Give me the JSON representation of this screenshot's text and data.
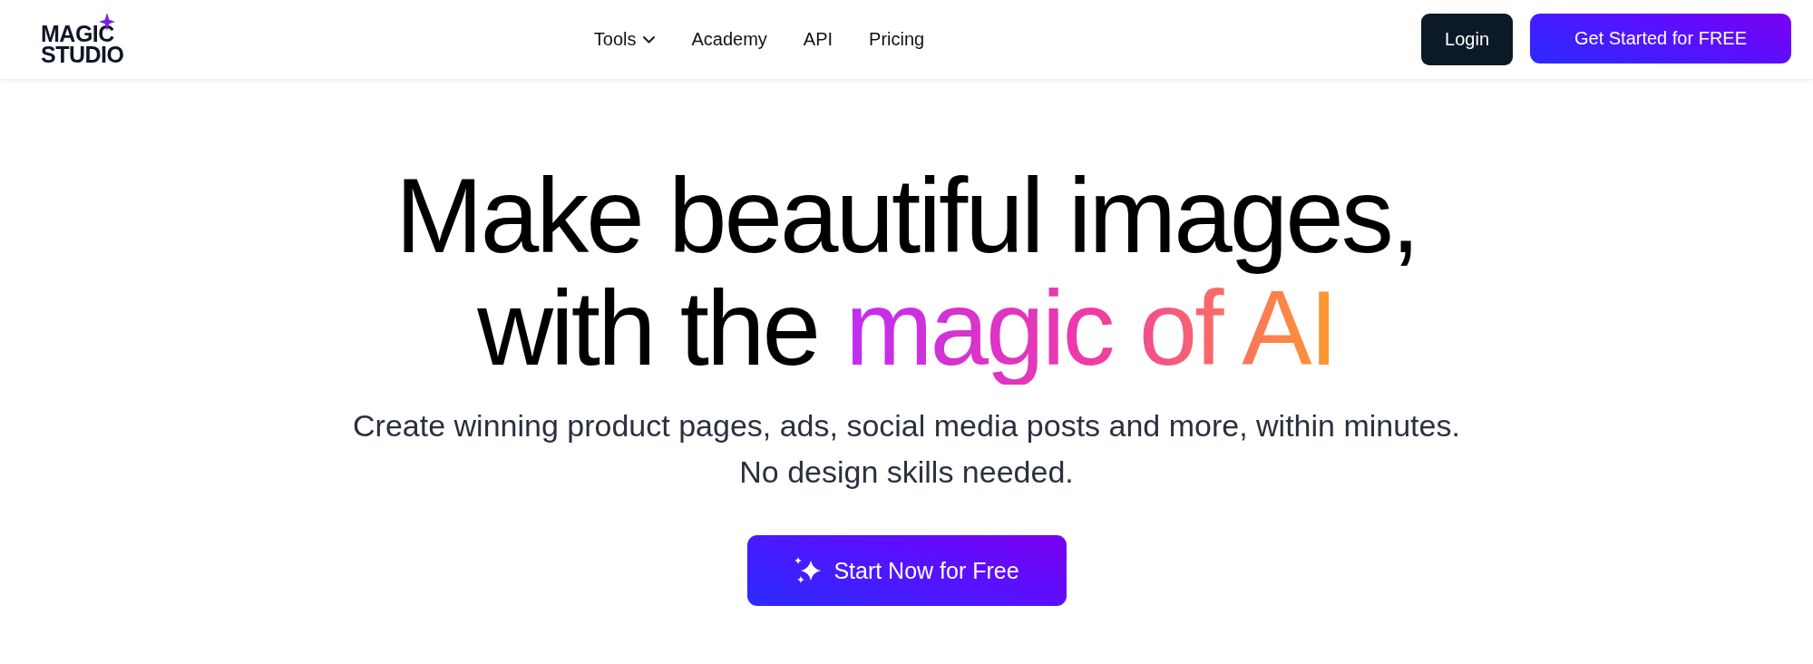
{
  "logo": {
    "line_1": "MAGIC",
    "line_2": "STUDIO"
  },
  "nav": [
    {
      "label": "Tools",
      "has_menu": true
    },
    {
      "label": "Academy",
      "has_menu": false
    },
    {
      "label": "API",
      "has_menu": false
    },
    {
      "label": "Pricing",
      "has_menu": false
    }
  ],
  "actions": {
    "login": "Login",
    "get_started": "Get Started for FREE"
  },
  "hero": {
    "headline_line_1": "Make beautiful images,",
    "headline_line_2": "with the",
    "headline_highlight": "magic of AI",
    "subtitle_line_1": "Create winning product pages, ads, social media posts and more, within minutes.",
    "subtitle_line_2": "No design skills needed.",
    "cta": "Start Now for Free"
  }
}
